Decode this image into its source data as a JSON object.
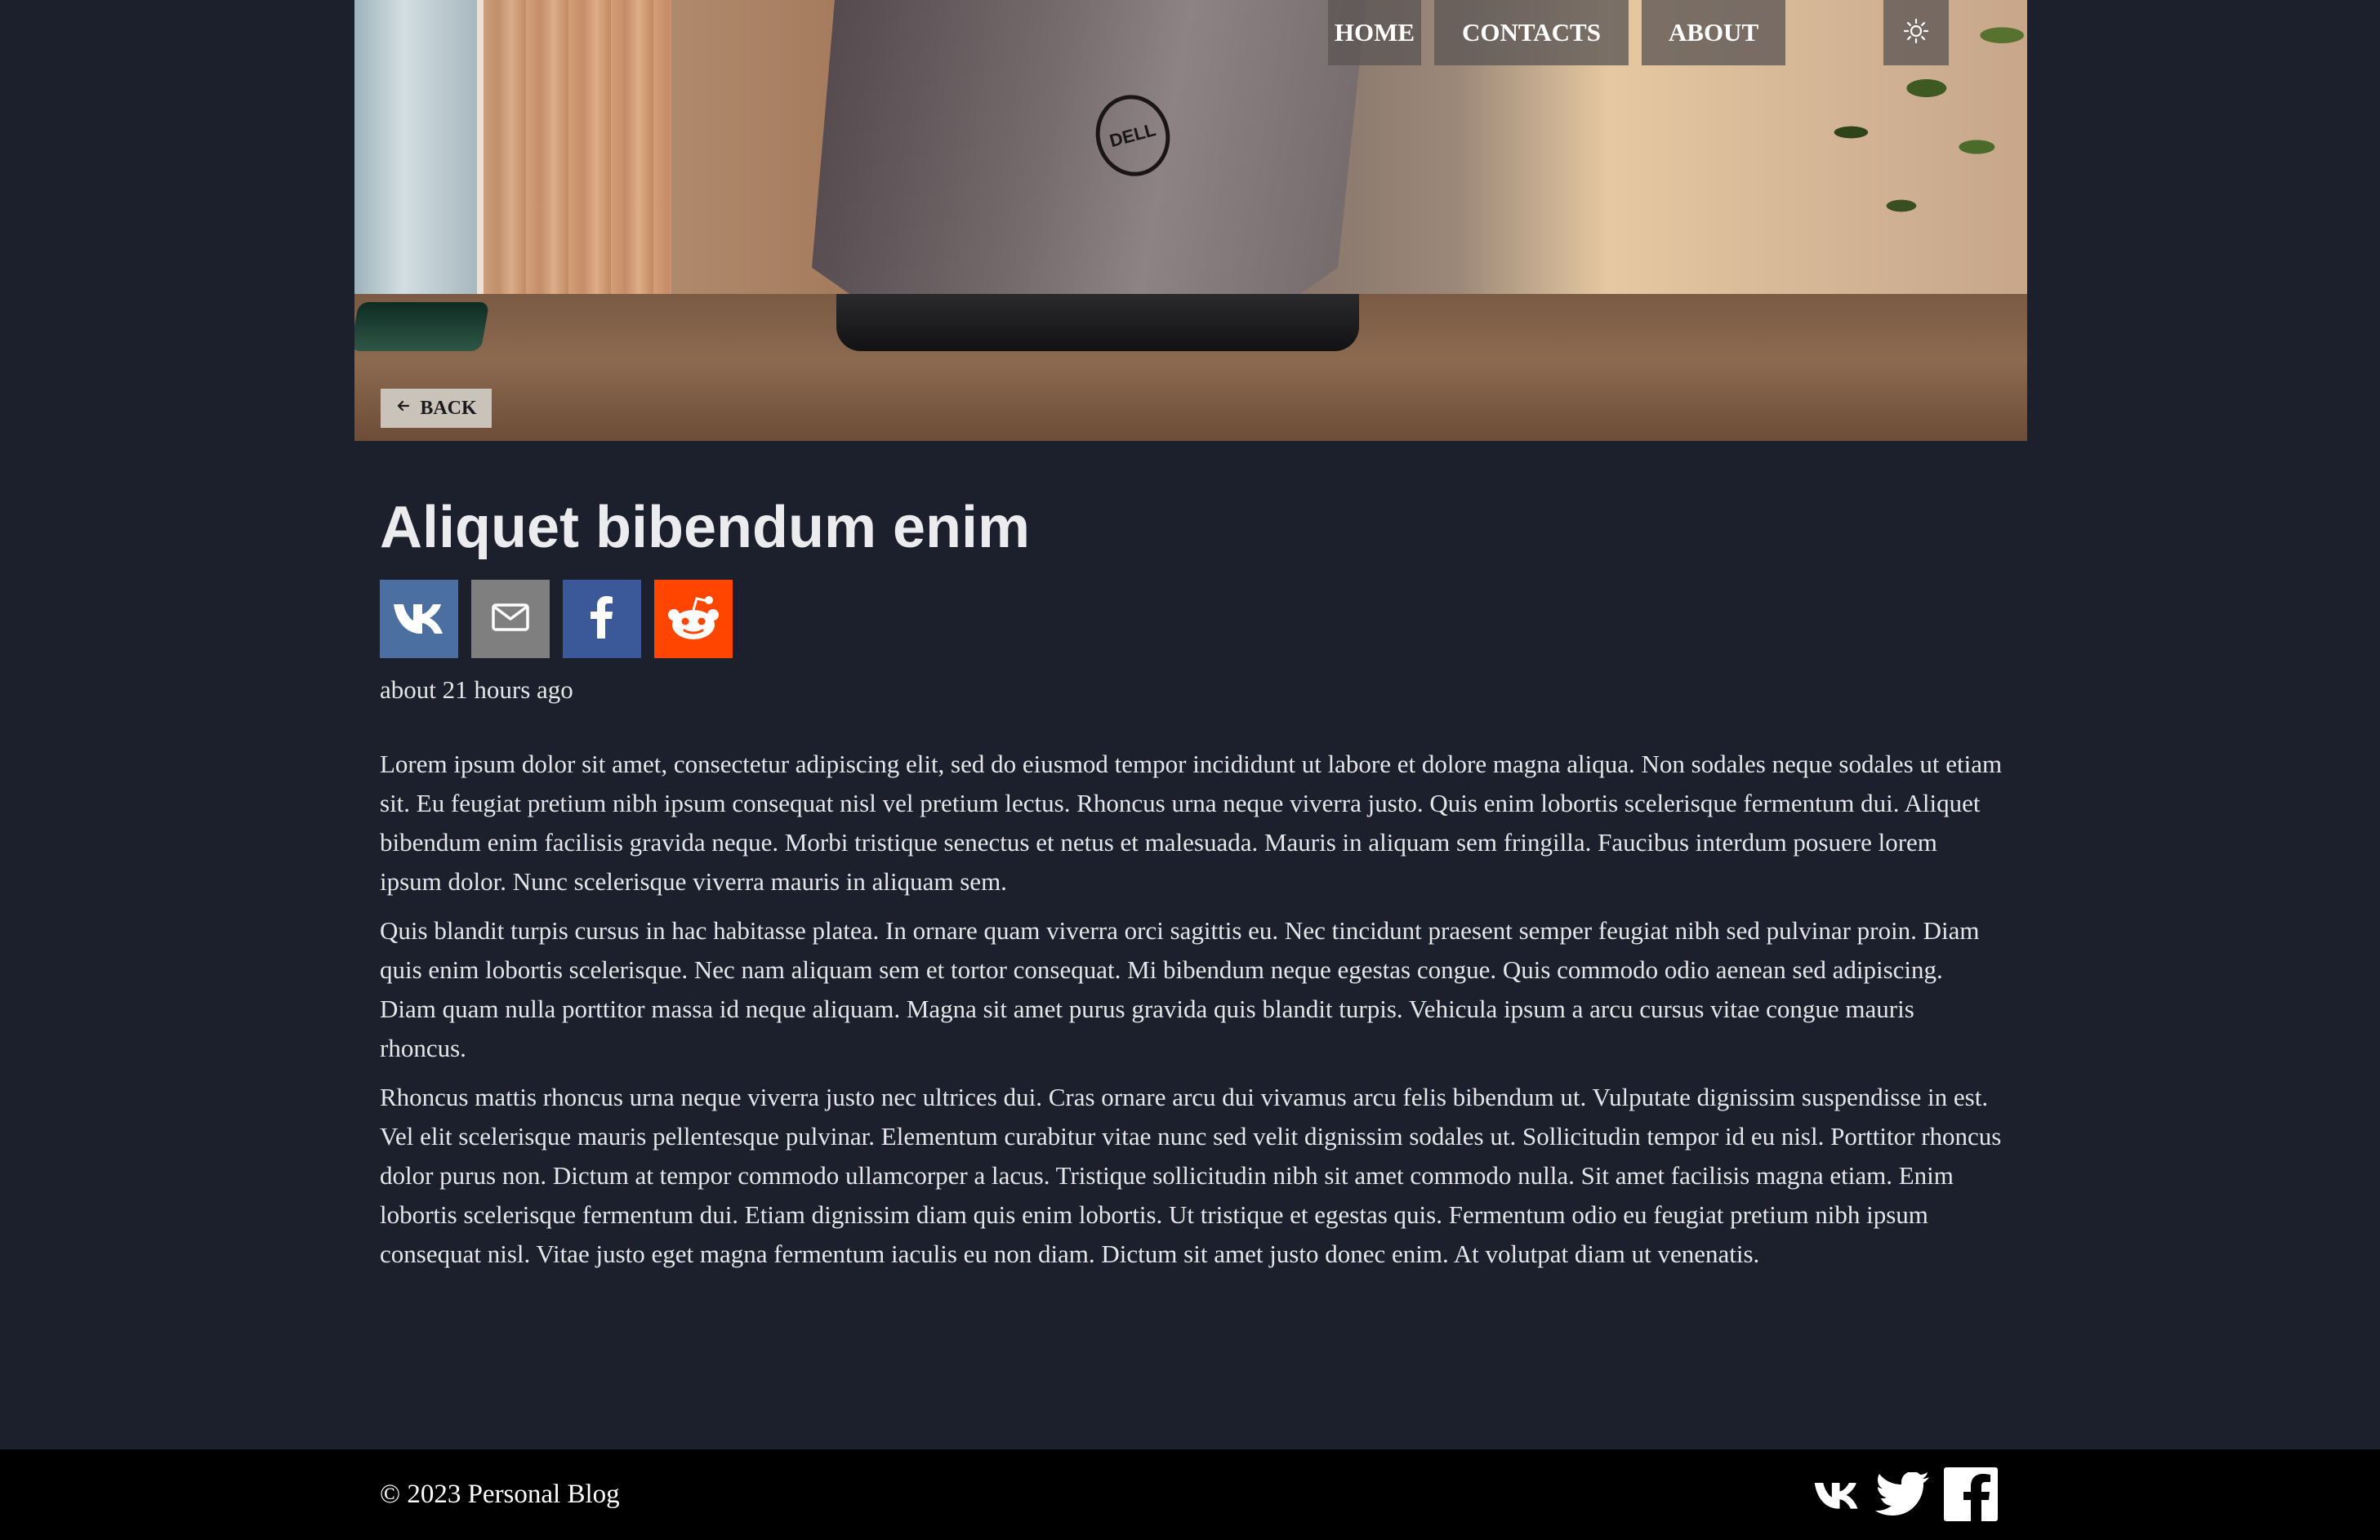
{
  "nav": {
    "home": "HOME",
    "contacts": "CONTACTS",
    "about": "ABOUT",
    "theme_icon": "sun-icon"
  },
  "hero": {
    "image": "laptop-on-desk-photo",
    "laptop_logo": "DELL",
    "back_label": "BACK",
    "back_icon": "arrow-left-icon"
  },
  "article": {
    "title": "Aliquet bibendum enim",
    "share": [
      {
        "icon": "vk-icon",
        "color": "#4a6fa0"
      },
      {
        "icon": "mail-icon",
        "color": "#7f7f7f"
      },
      {
        "icon": "facebook-icon",
        "color": "#3b5998"
      },
      {
        "icon": "reddit-icon",
        "color": "#ff4500"
      }
    ],
    "date": "about 21 hours ago",
    "paragraphs": [
      "Lorem ipsum dolor sit amet, consectetur adipiscing elit, sed do eiusmod tempor incididunt ut labore et dolore magna aliqua. Non sodales neque sodales ut etiam sit. Eu feugiat pretium nibh ipsum consequat nisl vel pretium lectus. Rhoncus urna neque viverra justo. Quis enim lobortis scelerisque fermentum dui. Aliquet bibendum enim facilisis gravida neque. Morbi tristique senectus et netus et malesuada. Mauris in aliquam sem fringilla. Faucibus interdum posuere lorem ipsum dolor. Nunc scelerisque viverra mauris in aliquam sem.",
      "Quis blandit turpis cursus in hac habitasse platea. In ornare quam viverra orci sagittis eu. Nec tincidunt praesent semper feugiat nibh sed pulvinar proin. Diam quis enim lobortis scelerisque. Nec nam aliquam sem et tortor consequat. Mi bibendum neque egestas congue. Quis commodo odio aenean sed adipiscing. Diam quam nulla porttitor massa id neque aliquam. Magna sit amet purus gravida quis blandit turpis. Vehicula ipsum a arcu cursus vitae congue mauris rhoncus.",
      "Rhoncus mattis rhoncus urna neque viverra justo nec ultrices dui. Cras ornare arcu dui vivamus arcu felis bibendum ut. Vulputate dignissim suspendisse in est. Vel elit scelerisque mauris pellentesque pulvinar. Elementum curabitur vitae nunc sed velit dignissim sodales ut. Sollicitudin tempor id eu nisl. Porttitor rhoncus dolor purus non. Dictum at tempor commodo ullamcorper a lacus. Tristique sollicitudin nibh sit amet commodo nulla. Sit amet facilisis magna etiam. Enim lobortis scelerisque fermentum dui. Etiam dignissim diam quis enim lobortis. Ut tristique et egestas quis. Fermentum odio eu feugiat pretium nibh ipsum consequat nisl. Vitae justo eget magna fermentum iaculis eu non diam. Dictum sit amet justo donec enim. At volutpat diam ut venenatis."
    ]
  },
  "footer": {
    "copyright": "© 2023 Personal Blog",
    "icons": [
      "vk-icon",
      "twitter-icon",
      "facebook-icon"
    ]
  },
  "colors": {
    "background": "#1c202c",
    "footer": "#000000",
    "text": "#e4e6ea"
  }
}
